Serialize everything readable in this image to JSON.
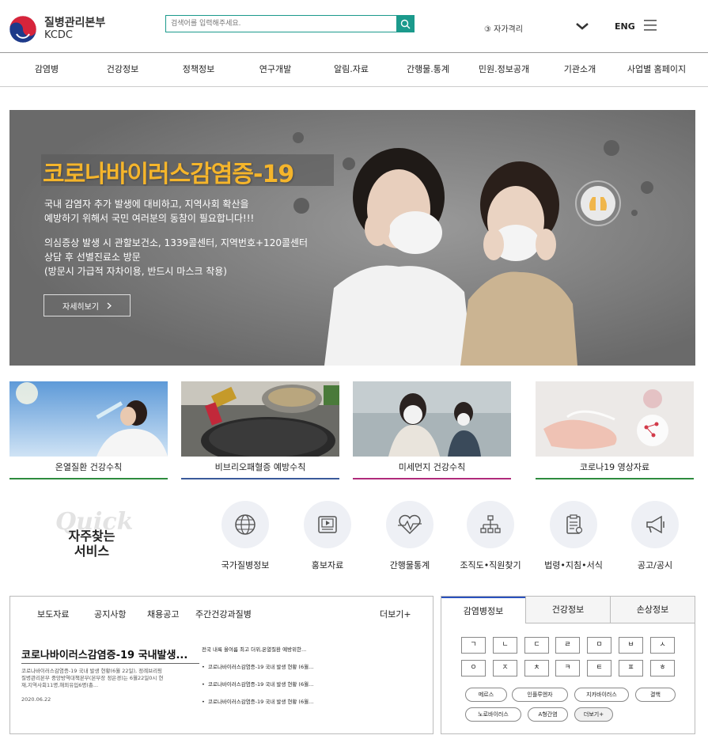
{
  "header": {
    "logo_korean": "질병관리본부",
    "logo_english": "KCDC",
    "search_placeholder": "검색어를 입력해주세요.",
    "self_check": "③ 자가격리",
    "lang": "ENG"
  },
  "gnb": [
    "감염병",
    "건강정보",
    "정책정보",
    "연구개발",
    "알림.자료",
    "간행물.통계",
    "민원.정보공개",
    "기관소개",
    "사업별 홈페이지"
  ],
  "hero": {
    "title": "코로나바이러스감염증-19",
    "p1_line1": "국내 감염자 추가 발생에 대비하고, 지역사회 확산을",
    "p1_line2": "예방하기 위해서 국민 여러분의 동참이 필요합니다!!!",
    "p2_line1": "의심증상 발생 시 관할보건소, 1339콜센터, 지역번호+120콜센터",
    "p2_line2": "상담 후 선별진료소 방문",
    "p2_line3": "(방문시 가급적 자차이용, 반드시 마스크 착용)",
    "more_label": "자세히보기"
  },
  "cards": [
    {
      "label": "온열질환 건강수칙",
      "line_color": "#2e8b3e"
    },
    {
      "label": "비브리오패혈증 예방수칙",
      "line_color": "#3a5a9a"
    },
    {
      "label": "미세먼지 건강수칙",
      "line_color": "#b02a7a"
    },
    {
      "label": "코로나19 영상자료",
      "line_color": "#2e8b3e"
    }
  ],
  "quick": {
    "bg_text": "Quick",
    "title_line1": "자주찾는",
    "title_line2": "서비스",
    "items": [
      {
        "label": "국가질병정보",
        "icon": "globe-icon"
      },
      {
        "label": "홍보자료",
        "icon": "media-player-icon"
      },
      {
        "label": "간행물통계",
        "icon": "heartbeat-icon"
      },
      {
        "label": "조직도•직원찾기",
        "icon": "org-chart-icon"
      },
      {
        "label": "법령•지침•서식",
        "icon": "clipboard-icon"
      },
      {
        "label": "공고/공시",
        "icon": "megaphone-icon"
      }
    ]
  },
  "news": {
    "tabs": [
      "보도자료",
      "공지사항",
      "채용공고",
      "주간건강과질병"
    ],
    "more": "더보기+",
    "headline": "코로나바이러스감염증-19 국내발생...",
    "body_line1": "코로나바이러스감염증-19 국내 발생 현황(6월 22일), 정례브리핑",
    "body_line2": "질병관리본부 중앙방역대책본부(본부장 정은경)는 6월22일0시 현",
    "body_line3": "재,지역사회11명,해외유입6명(총...",
    "date": "2020.06.22",
    "list": [
      "전국 내륙 올여름 최고 더위,온열질환 예방위한...",
      "코로나바이러스감염증-19 국내 발생 현황 (6월...",
      "코로나바이러스감염증-19 국내 발생 현황 (6월...",
      "코로나바이러스감염증-19 국내 발생 현황 (6월..."
    ]
  },
  "disease": {
    "tabs": [
      "감염병정보",
      "건강정보",
      "손상정보"
    ],
    "consonants_row1": [
      "ㄱ",
      "ㄴ",
      "ㄷ",
      "ㄹ",
      "ㅁ",
      "ㅂ",
      "ㅅ"
    ],
    "consonants_row2": [
      "ㅇ",
      "ㅈ",
      "ㅊ",
      "ㅋ",
      "ㅌ",
      "ㅍ",
      "ㅎ"
    ],
    "chips_row1": [
      "메르스",
      "인플루엔자",
      "지카바이러스",
      "결핵"
    ],
    "chips_row2": [
      "노로바이러스",
      "A형간염",
      "더보기+"
    ]
  },
  "colors": {
    "brand_teal": "#1b9a8c",
    "hero_title": "#f5b52b",
    "active_tab": "#2a52be"
  }
}
